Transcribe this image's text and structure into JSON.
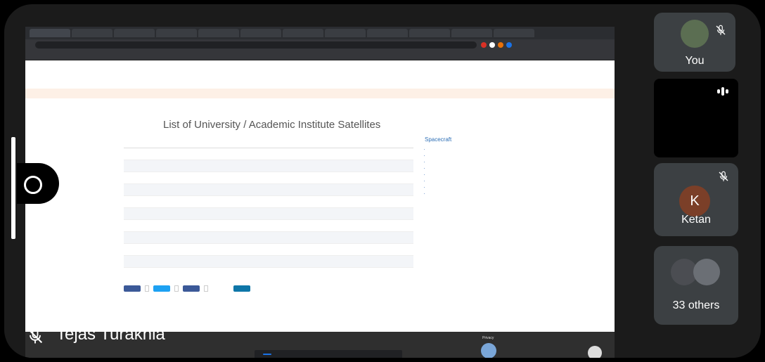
{
  "shared_screen": {
    "browser_tabs": [
      "",
      "",
      "",
      "",
      "",
      "",
      "",
      "",
      "",
      "",
      "",
      "",
      ""
    ],
    "address_bar": "",
    "bookmarks": [
      "",
      "",
      "",
      "",
      "",
      "",
      "",
      "",
      "",
      "",
      "",
      "",
      ""
    ],
    "page": {
      "nav_items": [
        "",
        "",
        "",
        "",
        "",
        "",
        "",
        "",
        ""
      ],
      "breadcrumb": "",
      "title": "List of University / Academic Institute Satellites",
      "table": {
        "columns": [
          "",
          "",
          "",
          "",
          "",
          ""
        ],
        "rows": [
          {
            "num": "",
            "name": "",
            "date": "",
            "mass": "",
            "vehicle": "",
            "remarks": ""
          },
          {
            "num": "",
            "name": "",
            "date": "",
            "mass": "",
            "vehicle": "",
            "remarks": ""
          },
          {
            "num": "",
            "name": "",
            "date": "",
            "mass": "",
            "vehicle": "",
            "remarks": ""
          },
          {
            "num": "",
            "name": "",
            "date": "",
            "mass": "",
            "vehicle": "",
            "remarks": ""
          },
          {
            "num": "",
            "name": "",
            "date": "",
            "mass": "",
            "vehicle": "",
            "remarks": ""
          },
          {
            "num": "",
            "name": "",
            "date": "",
            "mass": "",
            "vehicle": "",
            "remarks": ""
          },
          {
            "num": "",
            "name": "",
            "date": "",
            "mass": "",
            "vehicle": "",
            "remarks": ""
          },
          {
            "num": "",
            "name": "",
            "date": "",
            "mass": "",
            "vehicle": "",
            "remarks": ""
          },
          {
            "num": "",
            "name": "",
            "date": "",
            "mass": "",
            "vehicle": "",
            "remarks": ""
          },
          {
            "num": "",
            "name": "",
            "date": "",
            "mass": "",
            "vehicle": "",
            "remarks": ""
          }
        ]
      },
      "sidebar": {
        "title": "Spacecraft",
        "items": [
          "",
          "",
          "",
          "",
          "",
          "",
          "",
          ""
        ],
        "sub_item": ""
      },
      "footer": {
        "links": [
          "",
          "",
          "",
          "",
          "",
          "",
          ""
        ],
        "terms": "",
        "privacy": "Privacy"
      },
      "toast": {
        "text": "",
        "button": "",
        "hide": ""
      }
    }
  },
  "presenter": {
    "name": "Tejas Turakhia"
  },
  "participants": [
    {
      "label": "You"
    },
    {
      "label": ""
    },
    {
      "label": "Ketan",
      "initial": "K"
    },
    {
      "label": "33 others"
    }
  ]
}
